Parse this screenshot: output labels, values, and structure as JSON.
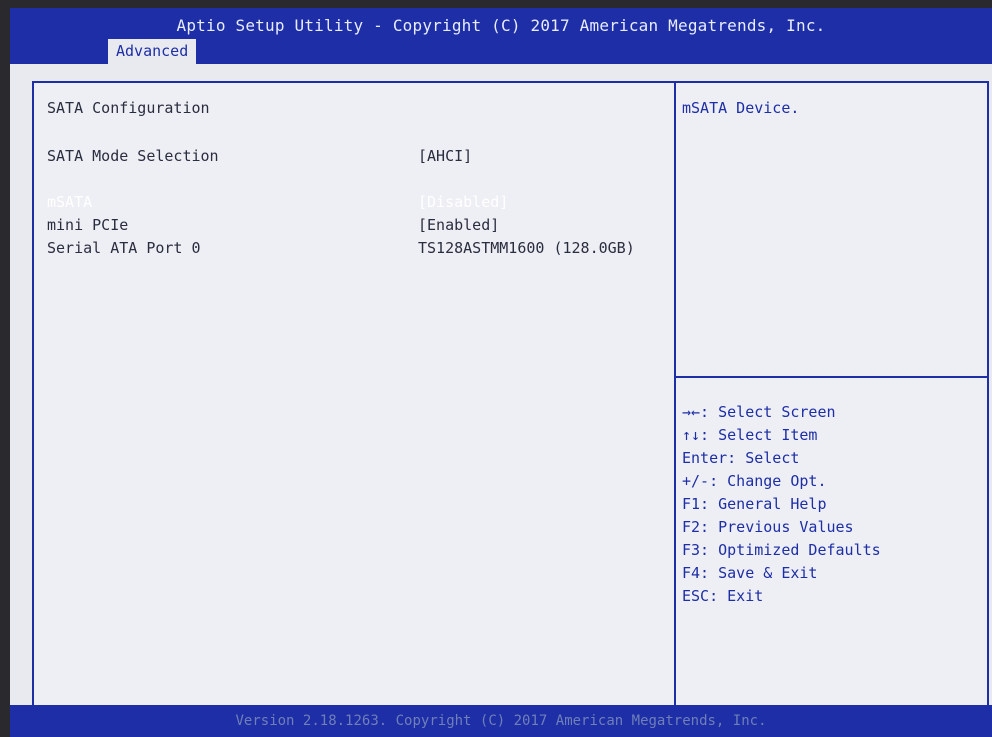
{
  "header": {
    "title": "Aptio Setup Utility - Copyright (C) 2017 American Megatrends, Inc.",
    "active_tab": "Advanced"
  },
  "main": {
    "section_title": "SATA Configuration",
    "items": [
      {
        "label": "SATA Mode Selection",
        "value": "[AHCI]"
      },
      {
        "label": "mSATA",
        "value": "[Disabled]",
        "selected": true
      },
      {
        "label": "mini PCIe",
        "value": "[Enabled]"
      },
      {
        "label": "Serial ATA Port 0",
        "value": "TS128ASTMM1600 (128.0GB)"
      }
    ]
  },
  "help": {
    "text": "mSATA Device."
  },
  "keys": [
    "→←: Select Screen",
    "↑↓: Select Item",
    "Enter: Select",
    "+/-: Change Opt.",
    "F1: General Help",
    "F2: Previous Values",
    "F3: Optimized Defaults",
    "F4: Save & Exit",
    "ESC: Exit"
  ],
  "footer": {
    "text": "Version 2.18.1263. Copyright (C) 2017 American Megatrends, Inc."
  }
}
